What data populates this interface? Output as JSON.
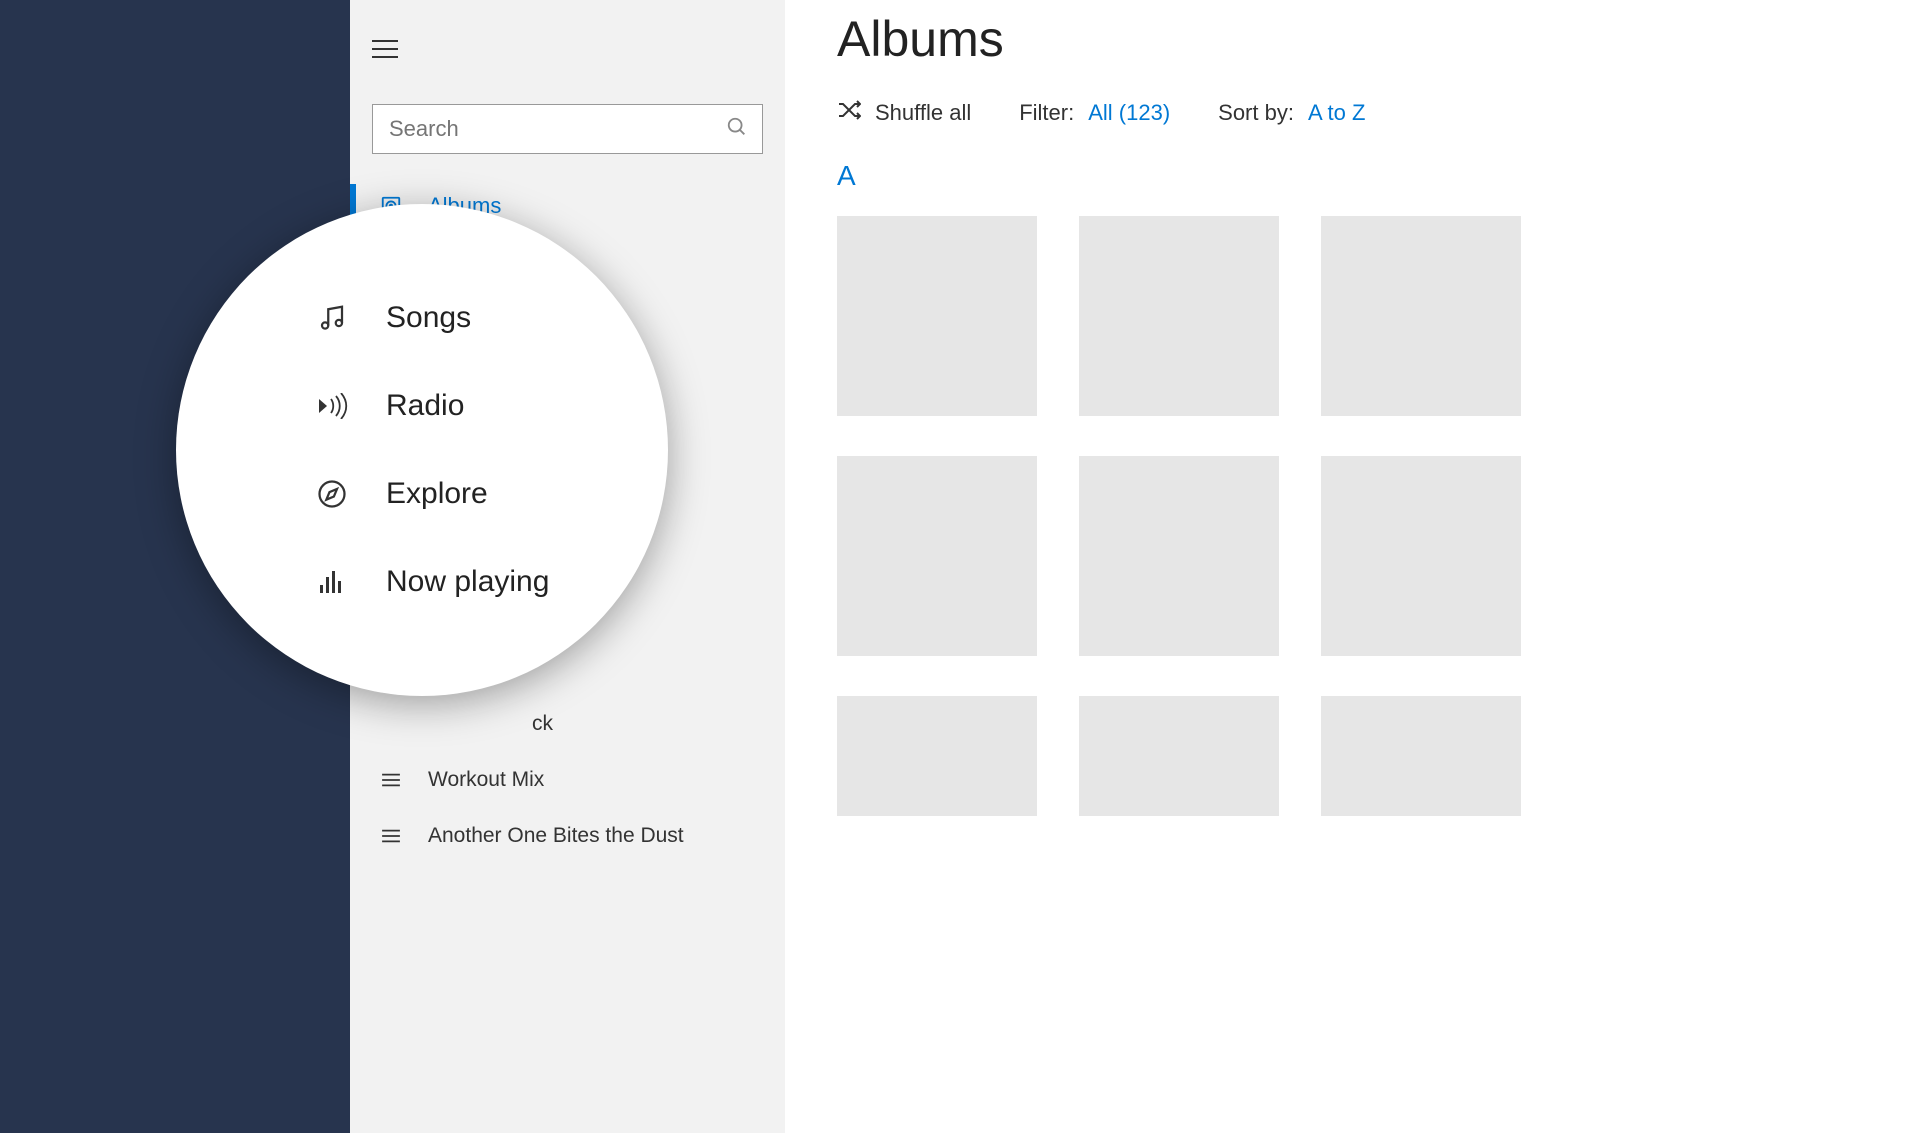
{
  "sidebar": {
    "search_placeholder": "Search",
    "nav": [
      {
        "label": "Albums",
        "icon": "album-icon",
        "active": true
      }
    ],
    "magnified_nav": [
      {
        "label": "Songs",
        "icon": "music-note-icon"
      },
      {
        "label": "Radio",
        "icon": "radio-icon"
      },
      {
        "label": "Explore",
        "icon": "compass-icon"
      },
      {
        "label": "Now playing",
        "icon": "now-playing-icon"
      }
    ],
    "playlists_partial_label": "ck",
    "playlists": [
      {
        "label": "Workout Mix"
      },
      {
        "label": "Another One Bites the Dust"
      }
    ]
  },
  "main": {
    "title": "Albums",
    "toolbar": {
      "shuffle_label": "Shuffle all",
      "filter_label": "Filter:",
      "filter_value": "All (123)",
      "sort_label": "Sort by:",
      "sort_value": "A to Z"
    },
    "section_letter": "A",
    "album_count": 9
  },
  "colors": {
    "accent": "#0078d4",
    "dark_bg": "#27344e",
    "sidebar_bg": "#f2f2f2",
    "tile_bg": "#e6e6e6"
  }
}
